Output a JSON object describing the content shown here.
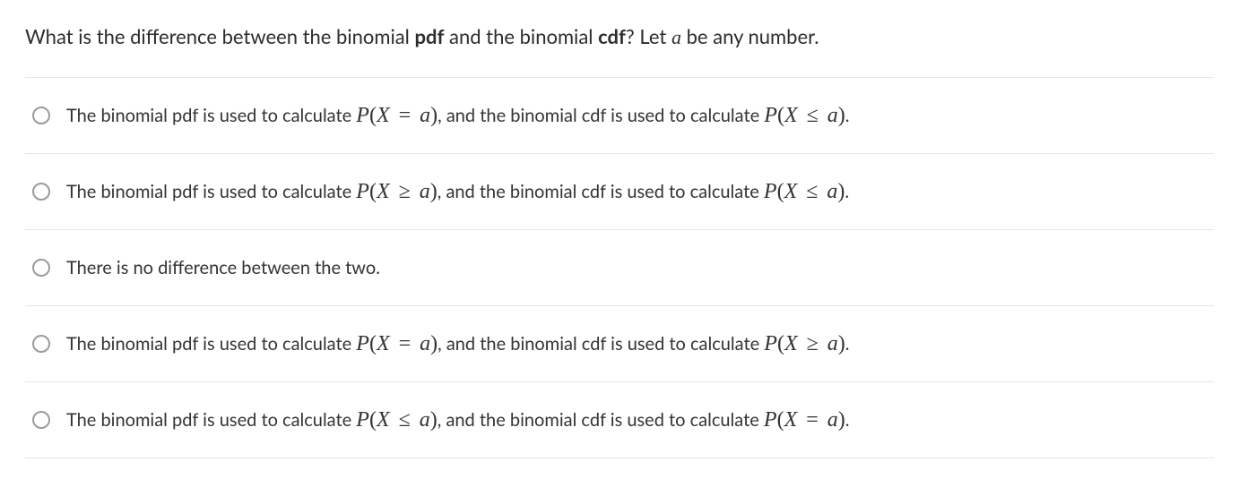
{
  "question": {
    "pre": "What is the difference between the binomial ",
    "b1": "pdf",
    "mid1": " and the binomial ",
    "b2": "cdf",
    "mid2": "? Let ",
    "var": "a",
    "post": " be any number."
  },
  "options": [
    {
      "pre": "The binomial pdf is used to calculate ",
      "pdf_math": "P(X = a)",
      "mid": ", and the binomial cdf is used to calculate ",
      "cdf_math": "P(X ≤ a)",
      "post": "."
    },
    {
      "pre": "The binomial pdf is used to calculate ",
      "pdf_math": "P(X ≥ a)",
      "mid": ", and the binomial cdf is used to calculate ",
      "cdf_math": "P(X ≤ a)",
      "post": "."
    },
    {
      "pre": "There is no difference between the two.",
      "pdf_math": "",
      "mid": "",
      "cdf_math": "",
      "post": ""
    },
    {
      "pre": "The binomial pdf is used to calculate ",
      "pdf_math": "P(X = a)",
      "mid": ", and the binomial cdf is used to calculate ",
      "cdf_math": "P(X ≥ a)",
      "post": "."
    },
    {
      "pre": "The binomial pdf is used to calculate ",
      "pdf_math": "P(X ≤ a)",
      "mid": ", and the binomial cdf is used to calculate ",
      "cdf_math": "P(X = a)",
      "post": "."
    }
  ]
}
